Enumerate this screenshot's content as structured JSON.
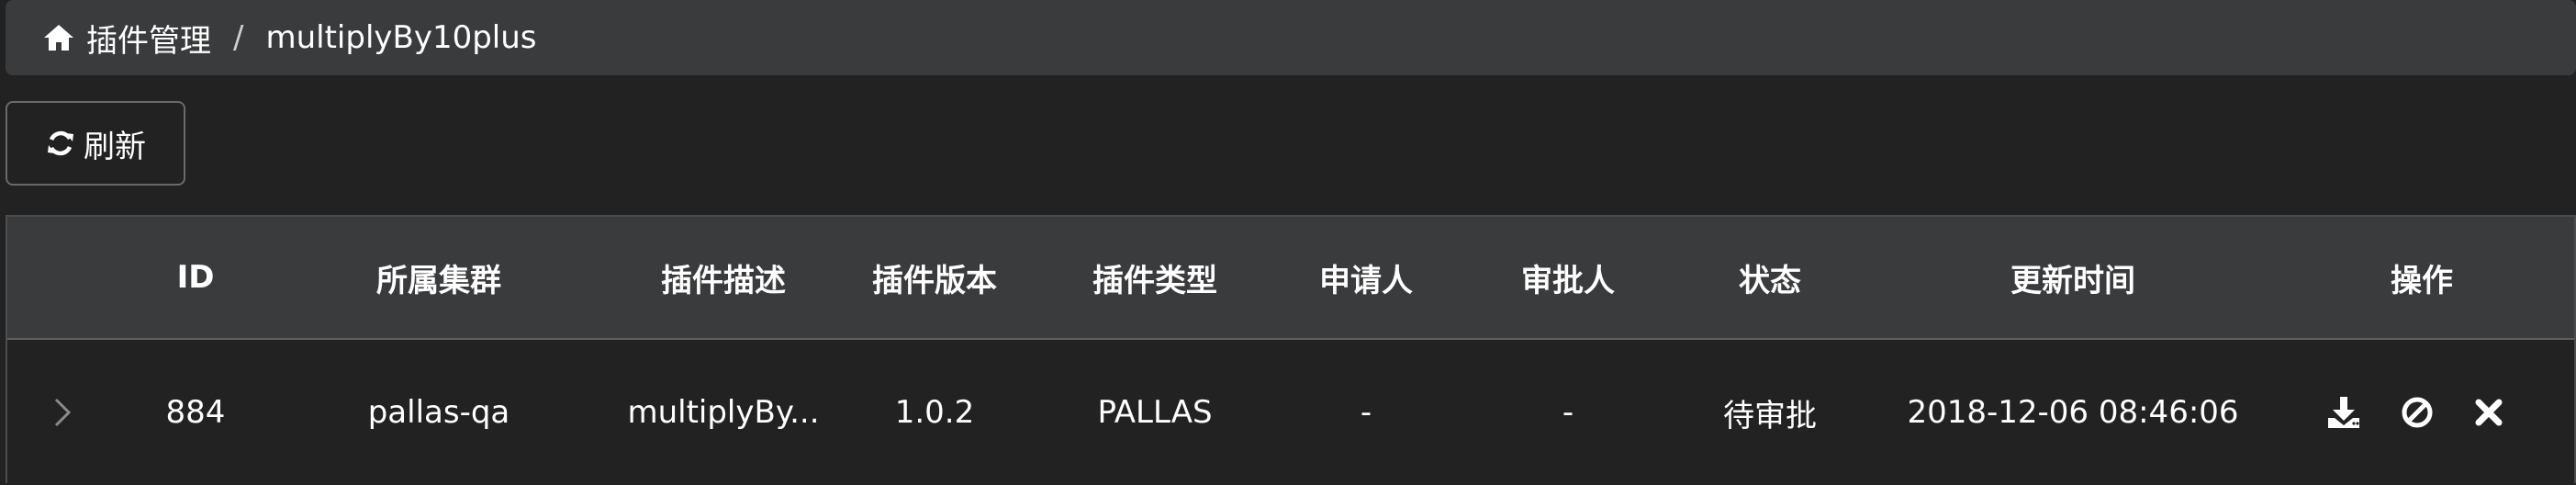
{
  "breadcrumb": {
    "root_label": "插件管理",
    "separator": "/",
    "current": "multiplyBy10plus"
  },
  "toolbar": {
    "refresh_label": "刷新"
  },
  "table": {
    "headers": [
      "ID",
      "所属集群",
      "插件描述",
      "插件版本",
      "插件类型",
      "申请人",
      "审批人",
      "状态",
      "更新时间",
      "操作"
    ],
    "rows": [
      {
        "id": "884",
        "cluster": "pallas-qa",
        "description": "multiplyBy...",
        "version": "1.0.2",
        "type": "PALLAS",
        "applicant": "-",
        "approver": "-",
        "status": "待审批",
        "updated": "2018-12-06 08:46:06",
        "actions": [
          "download-icon",
          "ban-icon",
          "close-icon"
        ]
      }
    ]
  }
}
